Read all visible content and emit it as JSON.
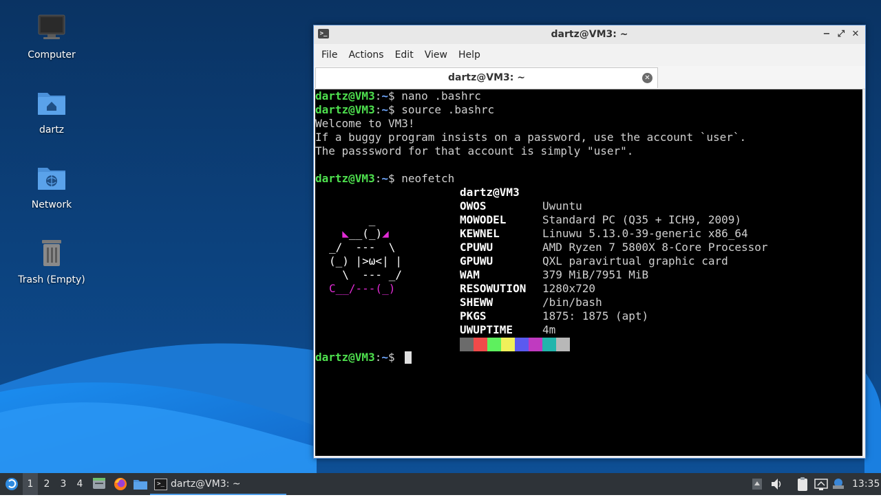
{
  "desktop": {
    "icons": [
      {
        "label": "Computer",
        "icon": "computer-icon"
      },
      {
        "label": "dartz",
        "icon": "home-folder-icon"
      },
      {
        "label": "Network",
        "icon": "network-folder-icon"
      },
      {
        "label": "Trash (Empty)",
        "icon": "trash-icon"
      }
    ]
  },
  "window": {
    "title": "dartz@VM3: ~",
    "controls": {
      "minimize": "−",
      "maximize": "⤢",
      "close": "✕"
    },
    "menu": [
      "File",
      "Actions",
      "Edit",
      "View",
      "Help"
    ],
    "tab": {
      "label": "dartz@VM3: ~",
      "close": "✕"
    }
  },
  "terminal": {
    "prompt_user": "dartz@VM3",
    "prompt_colon": ":",
    "prompt_path": "~",
    "prompt_dollar": "$ ",
    "commands": [
      "nano .bashrc",
      "source .bashrc",
      "neofetch"
    ],
    "output": [
      "Welcome to VM3!",
      "If a buggy program insists on a password, use the account `user`.",
      "The passsword for that account is simply \"user\"."
    ],
    "neofetch": {
      "header": "dartz@VM3",
      "ascii": [
        "      _",
        "  ◣__(_)◢",
        "_/  ---  \\",
        "(_) |>ω<| |",
        "  \\  --- _/",
        "C__/---(_)"
      ],
      "fields": [
        {
          "key": "OWOS",
          "value": "Uwuntu"
        },
        {
          "key": "MOWODEL",
          "value": "Standard PC (Q35 + ICH9, 2009)"
        },
        {
          "key": "KEWNEL",
          "value": "Linuwu 5.13.0-39-generic x86_64"
        },
        {
          "key": "CPUWU",
          "value": "AMD Ryzen 7 5800X 8-Core Processor"
        },
        {
          "key": "GPUWU",
          "value": "QXL paravirtual graphic card"
        },
        {
          "key": "WAM",
          "value": "379 MiB/7951 MiB"
        },
        {
          "key": "RESOWUTION",
          "value": "1280x720"
        },
        {
          "key": "SHEWW",
          "value": "/bin/bash"
        },
        {
          "key": "PKGS",
          "value": "1875: 1875 (apt)"
        },
        {
          "key": "UWUPTIME",
          "value": "4m"
        }
      ],
      "palette": [
        "#6b6b6b",
        "#f04a4a",
        "#5ef05e",
        "#f0f05a",
        "#5a5af0",
        "#c03ac0",
        "#22b5ac",
        "#b8b8b8"
      ]
    }
  },
  "taskbar": {
    "workspaces": [
      "1",
      "2",
      "3",
      "4"
    ],
    "active_workspace": "1",
    "launchers": [
      "file-manager-icon",
      "firefox-icon",
      "folder-icon"
    ],
    "task_label": "dartz@VM3: ~",
    "clock": "13:35"
  }
}
